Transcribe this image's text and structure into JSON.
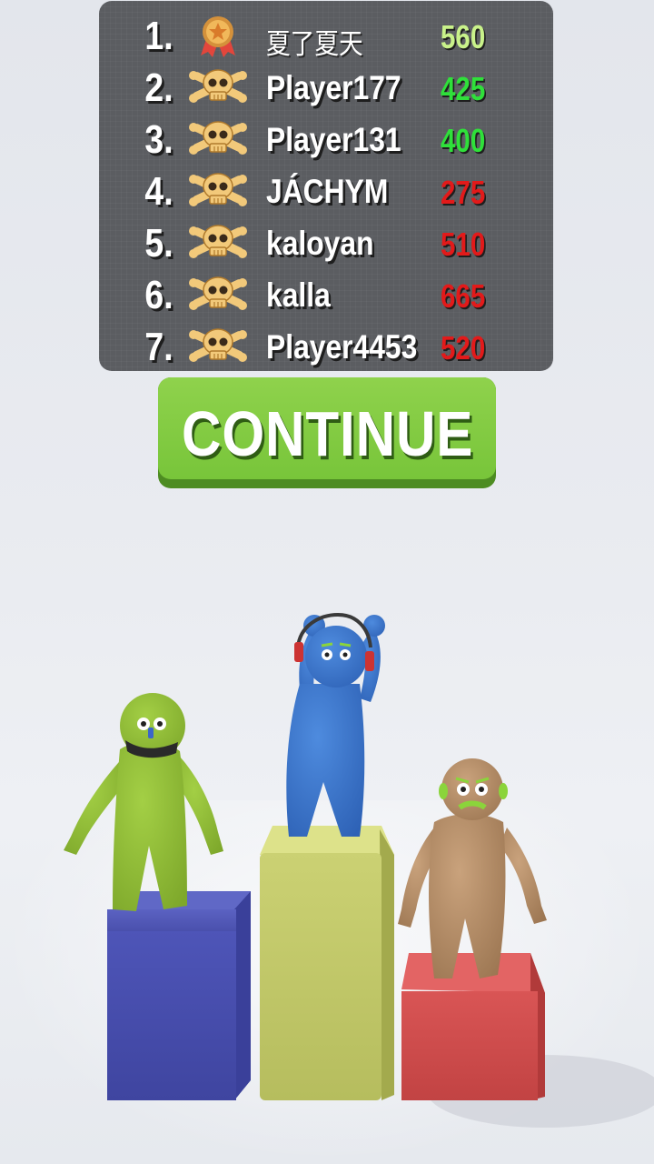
{
  "leaderboard": {
    "rows": [
      {
        "rank": "1.",
        "icon": "medal-icon",
        "name": "夏了夏天",
        "score": "560",
        "score_color": "#c9f28a"
      },
      {
        "rank": "2.",
        "icon": "skull-crossbones-icon",
        "name": "Player177",
        "score": "425",
        "score_color": "#2fe03a"
      },
      {
        "rank": "3.",
        "icon": "skull-crossbones-icon",
        "name": "Player131",
        "score": "400",
        "score_color": "#2fe03a"
      },
      {
        "rank": "4.",
        "icon": "skull-crossbones-icon",
        "name": "JÁCHYM",
        "score": "275",
        "score_color": "#e21a1a"
      },
      {
        "rank": "5.",
        "icon": "skull-crossbones-icon",
        "name": "kaloyan",
        "score": "510",
        "score_color": "#e21a1a"
      },
      {
        "rank": "6.",
        "icon": "skull-crossbones-icon",
        "name": "kalla",
        "score": "665",
        "score_color": "#e21a1a"
      },
      {
        "rank": "7.",
        "icon": "skull-crossbones-icon",
        "name": "Player4453",
        "score": "520",
        "score_color": "#e21a1a"
      }
    ]
  },
  "continue_button": {
    "label": "CONTINUE"
  },
  "podium": {
    "first": {
      "color": "#c7cd6e",
      "character": "blue-character"
    },
    "second": {
      "color": "#4b52b0",
      "character": "green-character"
    },
    "third": {
      "color": "#d14b4b",
      "character": "tan-character"
    }
  }
}
